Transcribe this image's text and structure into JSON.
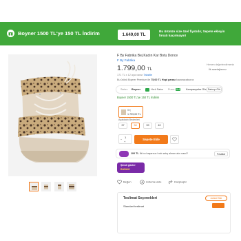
{
  "banner": {
    "title": "Boyner 1500 TL'ye 150 TL İndirim",
    "price": "1.649,00 TL",
    "note": "Bu ürünün size özel fiyatıdır, Sepete ekleyin fırsatı kaçırmayın!"
  },
  "product": {
    "title": "F By Fabrika Bej Kadın Kar Botu Donce",
    "brand": "F By Fabrika",
    "price_main": "1.799,00",
    "price_currency": "TL",
    "subline_prefix": "171 TL x 12 aya varan",
    "subline_link": "Taksitle",
    "right_info": "Hemen değerlendirmeniz",
    "right_info2": "İlk avantajlarınız",
    "campaign_text": "Bu ürünü Boyner Premium ile",
    "campaign_bold": "75,00 TL Hopi parası",
    "campaign_tail": "kazanacaksınız"
  },
  "seller": {
    "label": "Satıcı:",
    "name": "Boyner",
    "badge": "Hızlı Satıcı",
    "score_label": "Puan:",
    "score": "9.4",
    "bank_label": "Kampanyalar Gör",
    "follow": "Satıcıyı Gör"
  },
  "campaign_line": "Boyner 1500 TL'ye 150 TL İndirim",
  "variant": {
    "label": "Bej",
    "price": "1.799,00 TL"
  },
  "size_label": "Ayakkabı Bedenleri",
  "sizes": [
    "37",
    "38",
    "39",
    "40"
  ],
  "selected_size_index": 1,
  "quantity": "1",
  "cart_label": "Sepete Ekle",
  "promo1": {
    "text_bold": "100 TL",
    "text_rest": "İlk bu başarısız hızlı satış alman alın nasıl?",
    "detail": "Fırsatlar"
  },
  "promo2": {
    "line1": "Şimdi göster",
    "line2": "BABAM"
  },
  "actions": {
    "like": "Beğen",
    "list": "Listeme ekle",
    "compare": "Karşılaştır"
  },
  "shipping": {
    "heading": "Teslimat Seçenekleri",
    "tag": "Adresi Ekle",
    "option": "Standart teslimat"
  }
}
